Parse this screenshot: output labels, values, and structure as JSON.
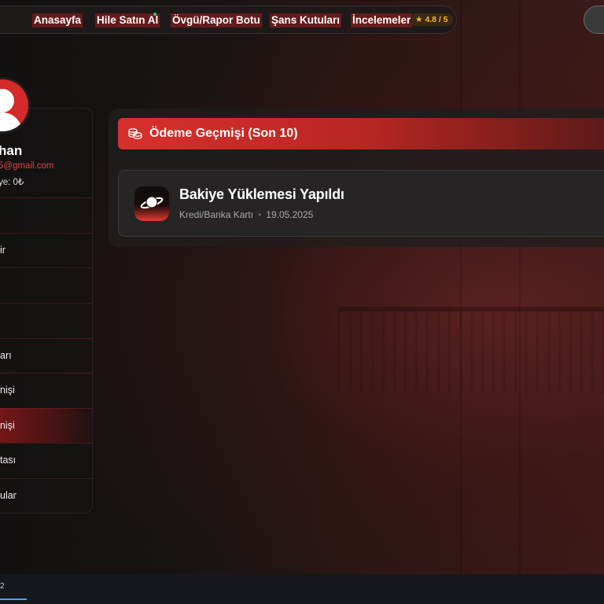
{
  "nav": {
    "items": [
      {
        "label": "Anasayfa"
      },
      {
        "label": "Hile Satın Al"
      },
      {
        "label": "Övgü/Rapor Botu"
      },
      {
        "label": "Şans Kutuları"
      },
      {
        "label": "İncelemeler"
      }
    ],
    "rating": "★ 4.8 / 5",
    "colors": {
      "accent": "#d8302c",
      "rating": "#f5b53a",
      "online_dot": "#2ecc71"
    }
  },
  "user": {
    "name_visible": "han",
    "email_visible": "5@gmail.com",
    "balance_visible": "ye: 0₺"
  },
  "sidebar": {
    "items": [
      {
        "label": ""
      },
      {
        "label": "ir"
      },
      {
        "label": ""
      },
      {
        "label": ""
      },
      {
        "label": "arı"
      },
      {
        "label": "nişi"
      },
      {
        "label": "nişi"
      },
      {
        "label": "tası"
      },
      {
        "label": "ular"
      }
    ],
    "active_index": 6
  },
  "payment_history": {
    "title_prefix": "Ödeme Geçmişi",
    "title_suffix": "(Son 10)",
    "icon": "coins-icon",
    "entries": [
      {
        "title": "Bakiye Yüklemesi Yapıldı",
        "method": "Kredi/Banka Kartı",
        "date": "19.05.2025",
        "icon": "planet-icon"
      }
    ]
  },
  "bottom_bar": {
    "tab_label": "2"
  }
}
